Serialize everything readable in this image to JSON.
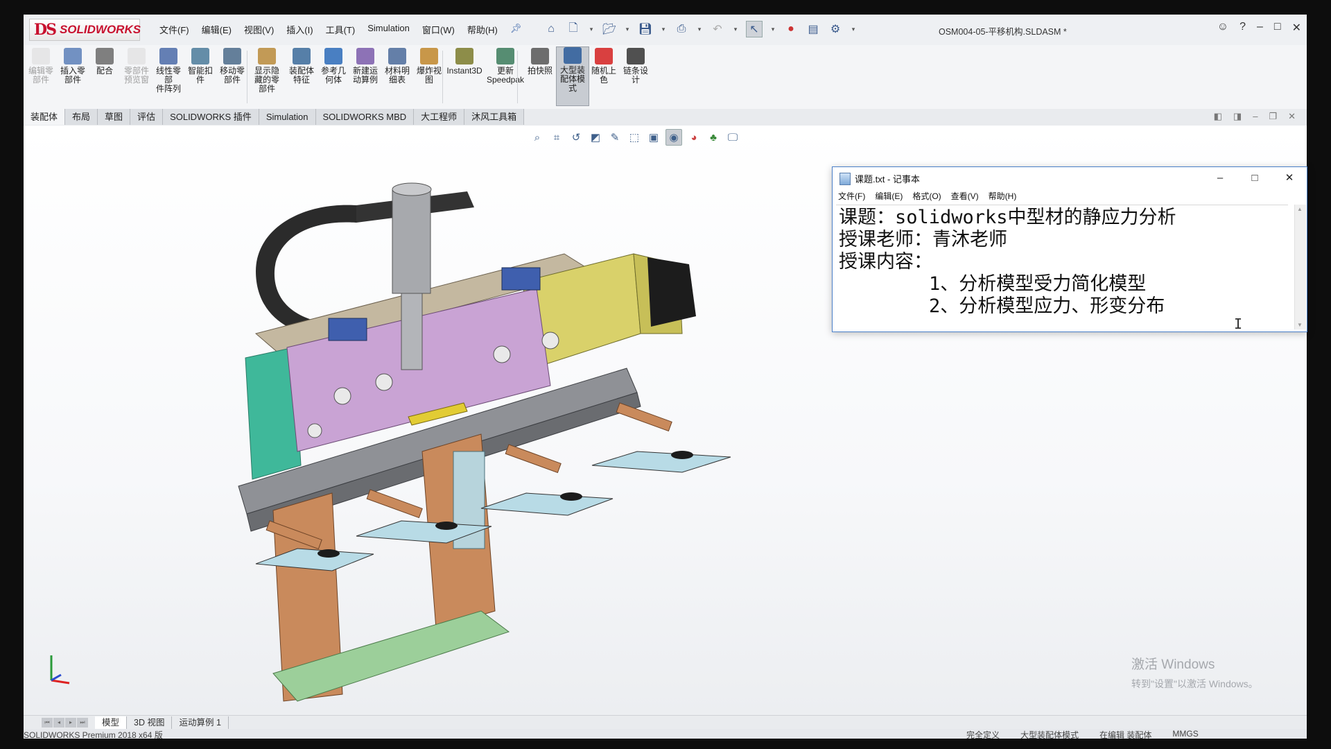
{
  "app": {
    "logo_mark": "DS",
    "logo_text": "SOLIDWORKS",
    "menu": [
      "文件(F)",
      "编辑(E)",
      "视图(V)",
      "插入(I)",
      "工具(T)",
      "Simulation",
      "窗口(W)",
      "帮助(H)"
    ],
    "document_title": "OSM004-05-平移机构.SLDASM *"
  },
  "ribbon": {
    "buttons": [
      {
        "label": "编辑零\n部件",
        "state": "disabled"
      },
      {
        "label": "插入零\n部件",
        "state": "normal"
      },
      {
        "label": "配合",
        "state": "normal"
      },
      {
        "label": "零部件\n预览窗",
        "state": "disabled"
      },
      {
        "label": "线性零部\n件阵列",
        "state": "normal"
      },
      {
        "label": "智能扣\n件",
        "state": "normal"
      },
      {
        "label": "移动零\n部件",
        "state": "normal"
      },
      {
        "label": "显示隐\n藏的零\n部件",
        "state": "normal"
      },
      {
        "label": "装配体\n特征",
        "state": "normal"
      },
      {
        "label": "参考几\n何体",
        "state": "normal"
      },
      {
        "label": "新建运\n动算例",
        "state": "normal"
      },
      {
        "label": "材料明\n细表",
        "state": "normal"
      },
      {
        "label": "爆炸视\n图",
        "state": "normal"
      },
      {
        "label": "Instant3D",
        "state": "normal"
      },
      {
        "label": "更新\nSpeedpak",
        "state": "normal"
      },
      {
        "label": "拍快照",
        "state": "normal"
      },
      {
        "label": "大型装\n配体模\n式",
        "state": "active"
      },
      {
        "label": "随机上\n色",
        "state": "normal"
      },
      {
        "label": "链条设\n计",
        "state": "normal"
      }
    ]
  },
  "tabs": [
    "装配体",
    "布局",
    "草图",
    "评估",
    "SOLIDWORKS 插件",
    "Simulation",
    "SOLIDWORKS MBD",
    "大工程师",
    "沐风工具箱"
  ],
  "active_tab": 0,
  "bottom_tabs": [
    "模型",
    "3D 视图",
    "运动算例 1"
  ],
  "status": {
    "left": "SOLIDWORKS Premium 2018 x64 版",
    "right": [
      "完全定义",
      "大型装配体模式",
      "在编辑 装配体",
      "MMGS"
    ]
  },
  "watermark": {
    "line1": "激活 Windows",
    "line2": "转到\"设置\"以激活 Windows。"
  },
  "notepad": {
    "title": "课题.txt - 记事本",
    "menu": [
      "文件(F)",
      "编辑(E)",
      "格式(O)",
      "查看(V)",
      "帮助(H)"
    ],
    "lines": [
      "课题：solidworks中型材的静应力分析",
      "授课老师：青沐老师",
      "授课内容：",
      "        1、分析模型受力简化模型",
      "        2、分析模型应力、形变分布"
    ]
  },
  "colors": {
    "brand": "#c8102e",
    "accent": "#4a7fc9",
    "plate_purple": "#c9a3d4",
    "frame_brown": "#c98a5c",
    "motor_yellow": "#d9d16a",
    "base_green": "#9ccf9a"
  }
}
